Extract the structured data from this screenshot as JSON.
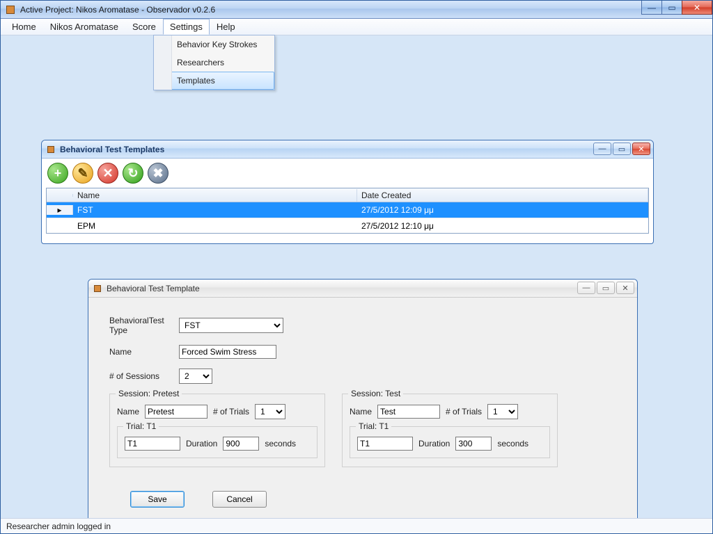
{
  "window": {
    "title": "Active Project: Nikos Aromatase - Observador v0.2.6"
  },
  "menu": {
    "items": [
      "Home",
      "Nikos Aromatase",
      "Score",
      "Settings",
      "Help"
    ],
    "open_index": 3,
    "dropdown": {
      "items": [
        "Behavior Key Strokes",
        "Researchers",
        "Templates"
      ],
      "hover_index": 2
    }
  },
  "templates_window": {
    "title": "Behavioral Test Templates",
    "columns": {
      "name": "Name",
      "date": "Date Created"
    },
    "rows": [
      {
        "name": "FST",
        "date": "27/5/2012 12:09 μμ",
        "selected": true
      },
      {
        "name": "EPM",
        "date": "27/5/2012 12:10 μμ",
        "selected": false
      }
    ]
  },
  "editor": {
    "title": "Behavioral Test Template",
    "labels": {
      "type": "BehavioralTest Type",
      "name": "Name",
      "sessions": "# of Sessions",
      "session_name": "Name",
      "trials": "# of Trials",
      "duration": "Duration",
      "seconds": "seconds"
    },
    "type_value": "FST",
    "name_value": "Forced Swim Stress",
    "sessions_value": "2",
    "session_a": {
      "legend": "Session: Pretest",
      "name": "Pretest",
      "trials": "1",
      "trial_legend": "Trial: T1",
      "trial_name": "T1",
      "duration": "900"
    },
    "session_b": {
      "legend": "Session: Test",
      "name": "Test",
      "trials": "1",
      "trial_legend": "Trial: T1",
      "trial_name": "T1",
      "duration": "300"
    },
    "buttons": {
      "save": "Save",
      "cancel": "Cancel"
    }
  },
  "status": "Researcher admin logged in"
}
